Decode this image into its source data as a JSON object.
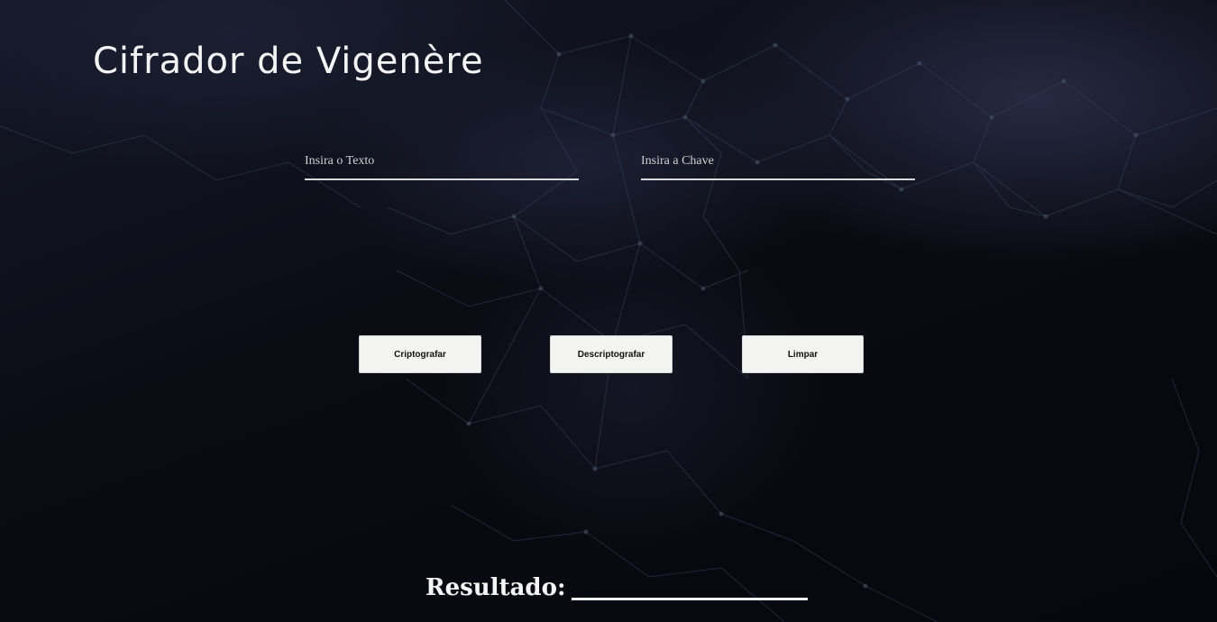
{
  "title": "Cifrador de Vigenère",
  "inputs": {
    "text": {
      "placeholder": "Insira o Texto",
      "value": ""
    },
    "key": {
      "placeholder": "Insira a Chave",
      "value": ""
    }
  },
  "buttons": {
    "encrypt": "Criptografar",
    "decrypt": "Descriptografar",
    "clear": "Limpar"
  },
  "result": {
    "label": "Resultado:",
    "value": ""
  }
}
